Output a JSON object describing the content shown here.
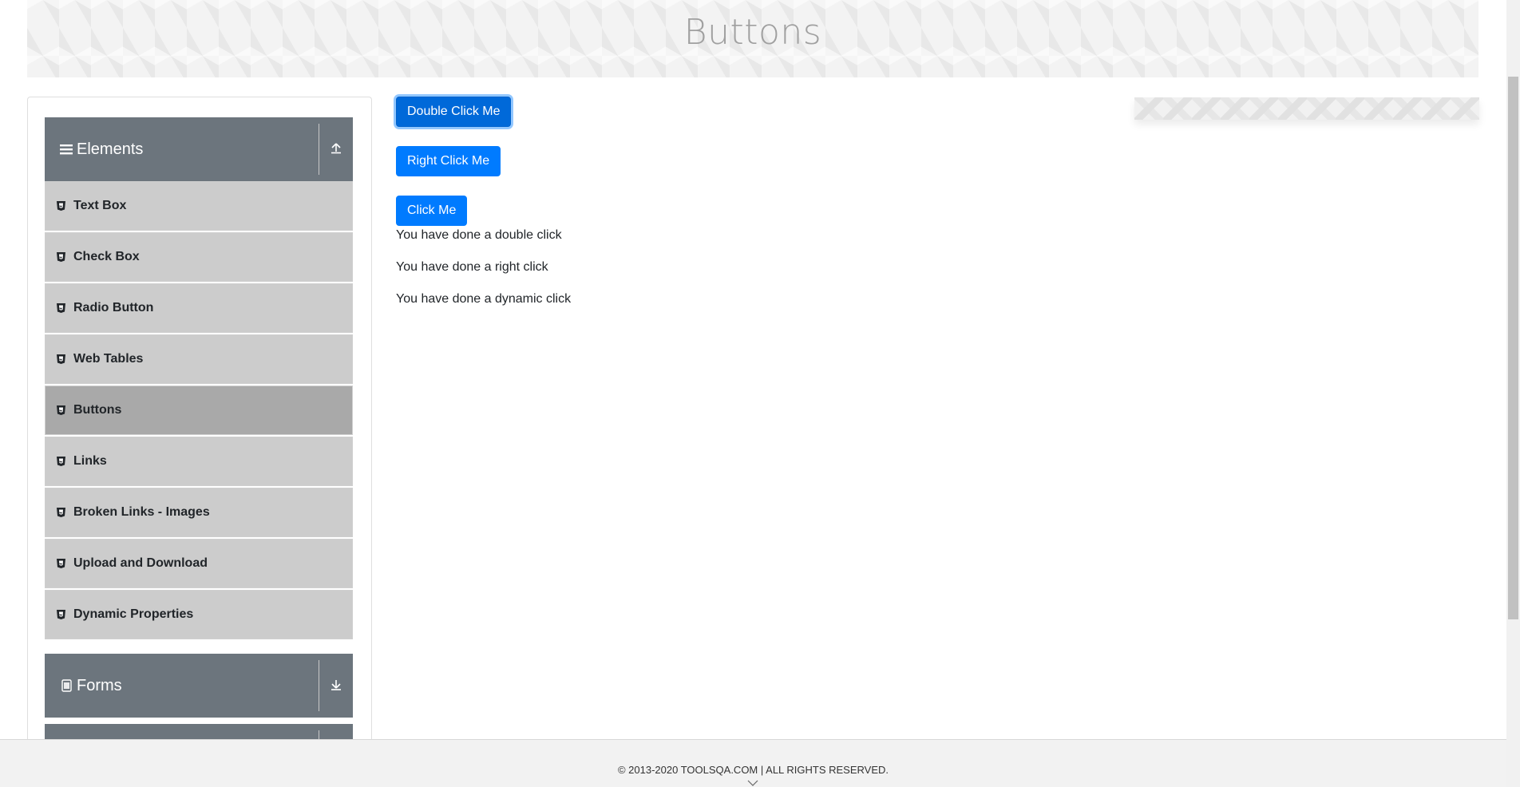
{
  "header": {
    "title": "Buttons"
  },
  "sidebar": {
    "groups": [
      {
        "label": "Elements",
        "icon": "hamburger-icon",
        "toggle_icon": "upload-arrow-icon",
        "expanded": true
      },
      {
        "label": "Forms",
        "icon": "document-icon",
        "toggle_icon": "download-arrow-icon",
        "expanded": false
      }
    ],
    "items": [
      {
        "label": "Text Box",
        "active": false
      },
      {
        "label": "Check Box",
        "active": false
      },
      {
        "label": "Radio Button",
        "active": false
      },
      {
        "label": "Web Tables",
        "active": false
      },
      {
        "label": "Buttons",
        "active": true
      },
      {
        "label": "Links",
        "active": false
      },
      {
        "label": "Broken Links - Images",
        "active": false
      },
      {
        "label": "Upload and Download",
        "active": false
      },
      {
        "label": "Dynamic Properties",
        "active": false
      }
    ]
  },
  "main": {
    "buttons": {
      "double_click": "Double Click Me",
      "right_click": "Right Click Me",
      "click": "Click Me"
    },
    "messages": {
      "double": "You have done a double click",
      "right": "You have done a right click",
      "dynamic": "You have done a dynamic click"
    }
  },
  "footer": {
    "text": "© 2013-2020 TOOLSQA.COM | ALL RIGHTS RESERVED."
  },
  "colors": {
    "primary": "#007bff",
    "group_header": "#6c757d",
    "menu_item": "#cccccc",
    "menu_active": "#a9a9a9"
  }
}
